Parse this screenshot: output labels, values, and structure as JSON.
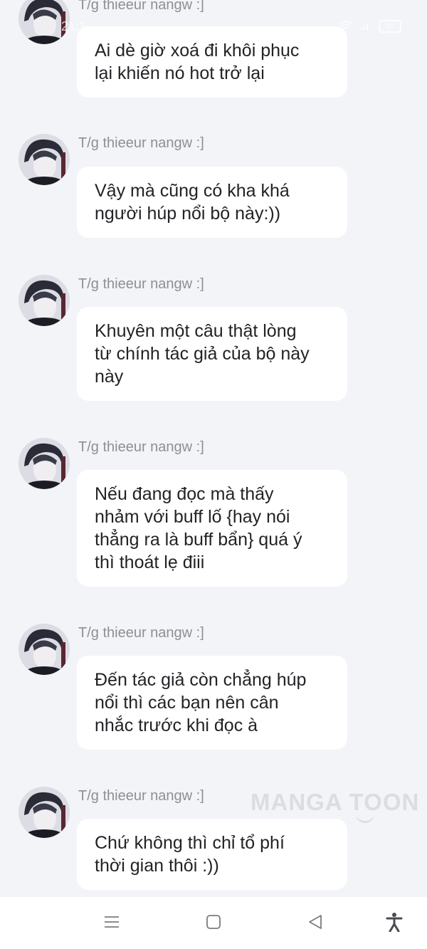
{
  "status_bar": {
    "time": "21:1",
    "battery": "92"
  },
  "messages": [
    {
      "author": "T/g thieeur nangw :]",
      "text": "Ai dè giờ xoá đi khôi phục\nlại khiến nó hot trở lại"
    },
    {
      "author": "T/g thieeur nangw :]",
      "text": "Vậy mà cũng có kha khá\nngười húp nổi bộ này:))"
    },
    {
      "author": "T/g thieeur nangw :]",
      "text": "Khuyên một câu thật lòng\ntừ chính tác giả của bộ này\nnày"
    },
    {
      "author": "T/g thieeur nangw :]",
      "text": "Nếu đang đọc mà thấy\nnhảm với buff lố {hay nói\nthẳng ra là buff bẩn} quá ý\nthì thoát lẹ điii"
    },
    {
      "author": "T/g thieeur nangw :]",
      "text": "Đến tác giả còn chẳng húp\nnổi thì các bạn nên cân\nnhắc trước khi đọc à"
    },
    {
      "author": "T/g thieeur nangw :]",
      "text": "Chứ không thì chỉ tổ phí\nthời gian thôi :))"
    }
  ],
  "watermark": "MANGA TOON",
  "nav_bar": {
    "buttons": [
      {
        "icon": "menu-icon"
      },
      {
        "icon": "home-square-icon"
      },
      {
        "icon": "back-triangle-icon"
      },
      {
        "icon": "accessibility-icon"
      }
    ]
  },
  "colors": {
    "background": "#f3f4f8",
    "bubble": "#ffffff",
    "author_text": "#8e8f94",
    "message_text": "#222326"
  }
}
